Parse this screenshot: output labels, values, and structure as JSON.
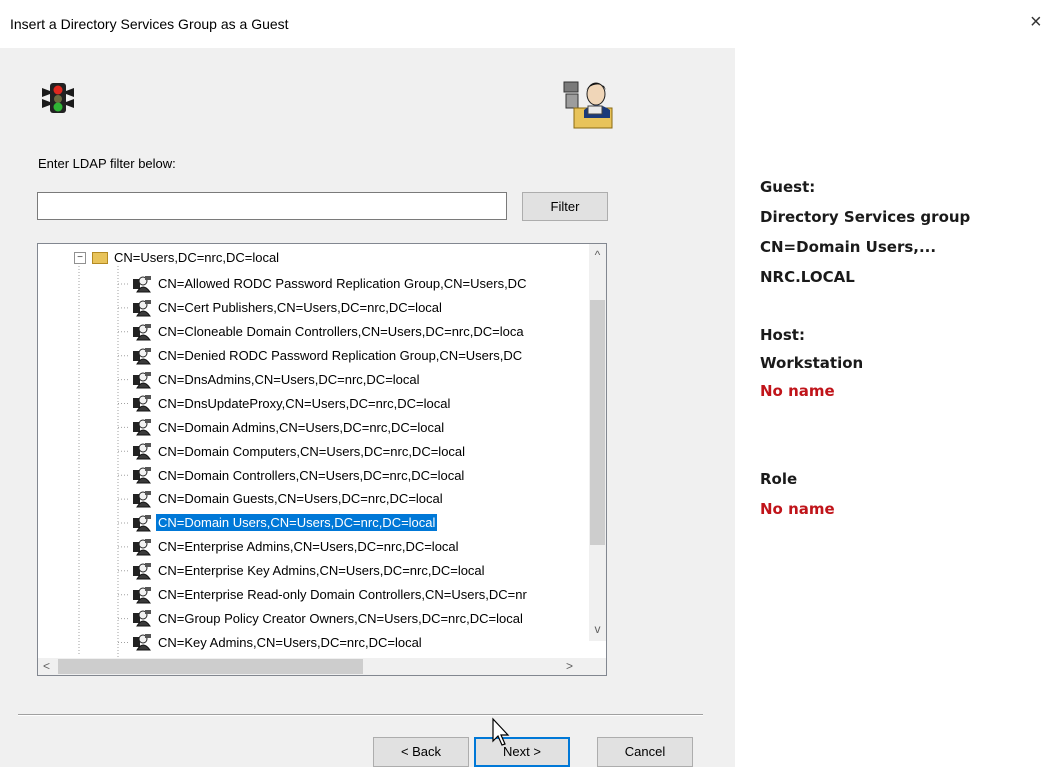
{
  "window": {
    "title": "Insert a Directory Services Group as a Guest",
    "close_glyph": "×"
  },
  "icons": {
    "top_left": "traffic-light-icon",
    "top_right": "wizard-person-icon",
    "row": "group-icon"
  },
  "filter": {
    "label": "Enter LDAP filter below:",
    "value": "",
    "button": "Filter"
  },
  "tree": {
    "expander": "−",
    "root": "CN=Users,DC=nrc,DC=local",
    "items": [
      "CN=Allowed RODC Password Replication Group,CN=Users,DC",
      "CN=Cert Publishers,CN=Users,DC=nrc,DC=local",
      "CN=Cloneable Domain Controllers,CN=Users,DC=nrc,DC=loca",
      "CN=Denied RODC Password Replication Group,CN=Users,DC",
      "CN=DnsAdmins,CN=Users,DC=nrc,DC=local",
      "CN=DnsUpdateProxy,CN=Users,DC=nrc,DC=local",
      "CN=Domain Admins,CN=Users,DC=nrc,DC=local",
      "CN=Domain Computers,CN=Users,DC=nrc,DC=local",
      "CN=Domain Controllers,CN=Users,DC=nrc,DC=local",
      "CN=Domain Guests,CN=Users,DC=nrc,DC=local",
      "CN=Domain Users,CN=Users,DC=nrc,DC=local",
      "CN=Enterprise Admins,CN=Users,DC=nrc,DC=local",
      "CN=Enterprise Key Admins,CN=Users,DC=nrc,DC=local",
      "CN=Enterprise Read-only Domain Controllers,CN=Users,DC=nr",
      "CN=Group Policy Creator Owners,CN=Users,DC=nrc,DC=local",
      "CN=Key Admins,CN=Users,DC=nrc,DC=local"
    ],
    "selected_index": 10,
    "scroll_up": "^",
    "scroll_down": "v",
    "scroll_left": "<",
    "scroll_right": ">"
  },
  "buttons": {
    "back": "< Back",
    "next": "Next >",
    "cancel": "Cancel"
  },
  "info": {
    "guest_label": "Guest:",
    "guest_type": "Directory Services group",
    "guest_name": "CN=Domain Users,...",
    "guest_domain": "NRC.LOCAL",
    "host_label": "Host:",
    "host_type": "Workstation",
    "host_name": "No name",
    "role_label": "Role",
    "role_value": "No name"
  },
  "colors": {
    "selection": "#0078d7",
    "alert_text": "#c0141a",
    "dialog_bg": "#f0f0f0"
  }
}
